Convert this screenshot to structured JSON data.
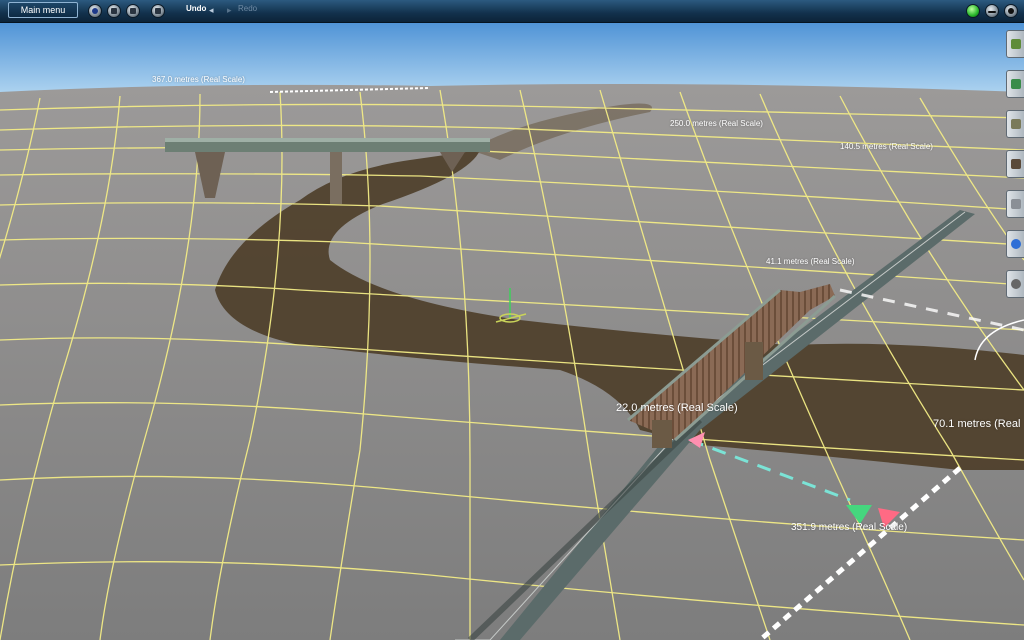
{
  "toolbar": {
    "main_menu_label": "Main menu",
    "undo_label": "Undo",
    "redo_label": "Redo"
  },
  "distance_labels": [
    {
      "text": "367.0 metres  (Real Scale)"
    },
    {
      "text": "250.0 metres  (Real Scale)"
    },
    {
      "text": "140.5 metres  (Real Scale)"
    },
    {
      "text": "41.1 metres  (Real Scale)"
    },
    {
      "text": "22.0 metres  (Real Scale)"
    },
    {
      "text": "70.1 metres  (Real"
    },
    {
      "text": "351.9 metres  (Real Scale)"
    }
  ],
  "colors": {
    "sky": "#6fa9dc",
    "terrain": "#8b8a8a",
    "grid": "#f5ee8a",
    "river": "#4a3a22",
    "toolbar": "#1a3d5c"
  },
  "palette_tools": [
    "terrain-tool-icon",
    "track-tool-icon",
    "objects-tool-icon",
    "textures-tool-icon",
    "tools-wrench-icon",
    "water-tool-icon",
    "settings-tool-icon"
  ]
}
